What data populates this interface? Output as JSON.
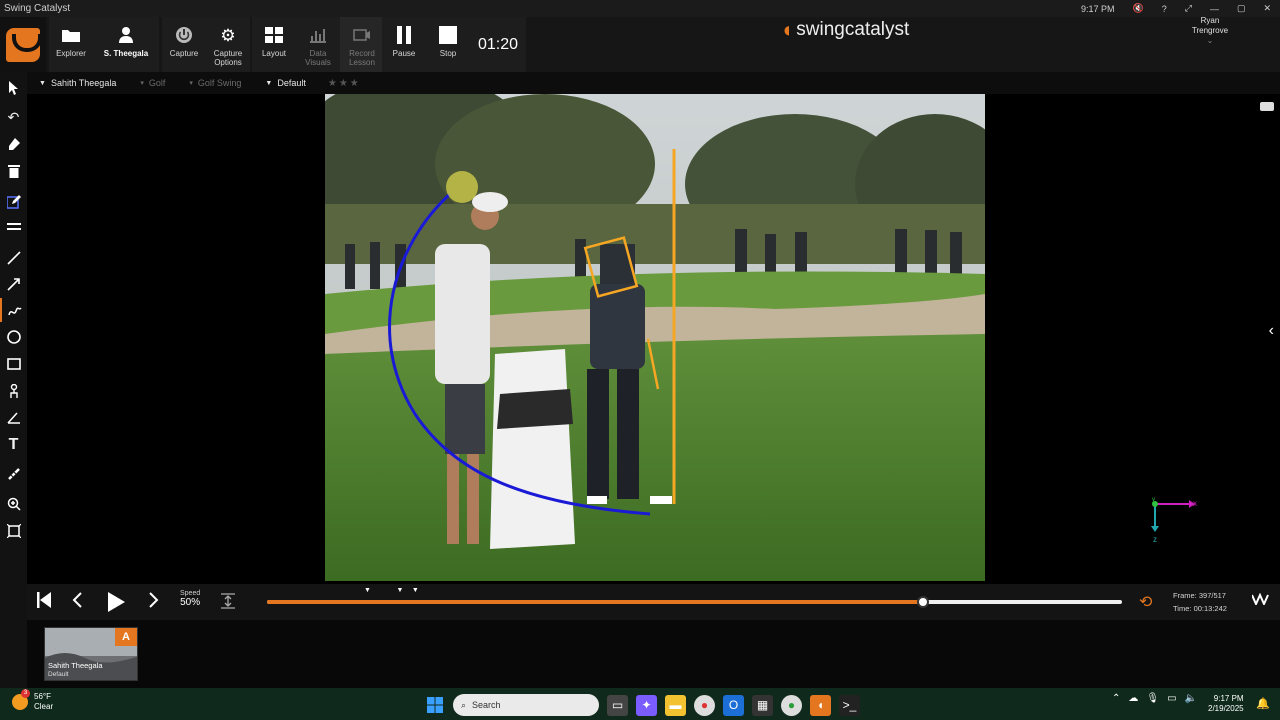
{
  "window": {
    "title": "Swing Catalyst",
    "time": "9:17 PM"
  },
  "toolbar": {
    "explorer": "Explorer",
    "athlete": "S. Theegala",
    "capture": "Capture",
    "capture_options": "Capture Options",
    "layout": "Layout",
    "data_visuals": "Data Visuals",
    "record_lesson": "Record Lesson",
    "pause": "Pause",
    "stop": "Stop",
    "timer": "01:20"
  },
  "brand": {
    "name": "swingcatalyst"
  },
  "user": {
    "first": "Ryan",
    "last": "Trengrove"
  },
  "breadcrumbs": [
    {
      "label": "Sahith Theegala",
      "active": true
    },
    {
      "label": "Golf",
      "active": false
    },
    {
      "label": "Golf Swing",
      "active": false
    },
    {
      "label": "Default",
      "active": true
    }
  ],
  "rating": {
    "stars": 3,
    "filled": 0
  },
  "tools": [
    "pointer-icon",
    "undo-icon",
    "eraser-icon",
    "trash-icon",
    "edit-icon",
    "lines-icon",
    "line-icon",
    "arrow-icon",
    "freehand-icon",
    "circle-icon",
    "rectangle-icon",
    "angle-icon",
    "angle2-icon",
    "text-icon",
    "measure-icon",
    "zoom-icon",
    "crop-icon"
  ],
  "axes": {
    "x": "x",
    "y": "y",
    "z": "z"
  },
  "playback": {
    "speed_label": "Speed",
    "speed_value": "50%",
    "progress": 0.767,
    "markers": [
      0.117,
      0.155,
      0.173
    ],
    "frame_label": "Frame:",
    "frame_value": "397/517",
    "time_label": "Time:",
    "time_value": "00:13:242"
  },
  "clip": {
    "badge": "A",
    "name": "Sahith Theegala",
    "sub": "Default"
  },
  "taskbar": {
    "temp": "56°F",
    "condition": "Clear",
    "notif": "3",
    "search_placeholder": "Search",
    "time": "9:17 PM",
    "date": "2/19/2025"
  },
  "colors": {
    "accent": "#e4761f",
    "line_blue": "#1a1ad6",
    "line_orange": "#f5a623"
  }
}
